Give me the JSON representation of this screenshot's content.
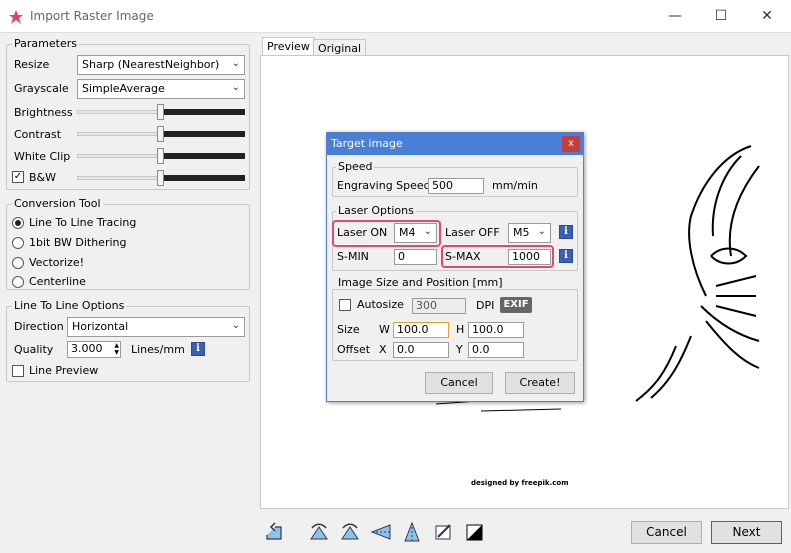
{
  "window": {
    "title": "Import Raster Image",
    "minimize": "—",
    "maximize": "☐",
    "close": "✕"
  },
  "parameters": {
    "title": "Parameters",
    "resize_label": "Resize",
    "resize_value": "Sharp (NearestNeighbor)",
    "grayscale_label": "Grayscale",
    "grayscale_value": "SimpleAverage",
    "brightness_label": "Brightness",
    "contrast_label": "Contrast",
    "white_clip_label": "White Clip",
    "bw_label": "B&W",
    "bw_checked": true,
    "slider_level": 0.5
  },
  "conversion_tool": {
    "title": "Conversion Tool",
    "options": [
      "Line To Line Tracing",
      "1bit BW Dithering",
      "Vectorize!",
      "Centerline"
    ],
    "selected": 0
  },
  "line_options": {
    "title": "Line To Line Options",
    "direction_label": "Direction",
    "direction_value": "Horizontal",
    "quality_label": "Quality",
    "quality_value": "3.000",
    "quality_unit": "Lines/mm",
    "line_preview_label": "Line Preview"
  },
  "tabs": [
    "Preview",
    "Original"
  ],
  "preview": {
    "credit": "designed by  freepik.com"
  },
  "dialog": {
    "title": "Target image",
    "close": "x",
    "speed_group": "Speed",
    "engraving_speed_label": "Engraving Speed",
    "engraving_speed_value": "500",
    "speed_unit": "mm/min",
    "laser_group": "Laser Options",
    "laser_on_label": "Laser ON",
    "laser_on_value": "M4",
    "laser_off_label": "Laser OFF",
    "laser_off_value": "M5",
    "smin_label": "S-MIN",
    "smin_value": "0",
    "smax_label": "S-MAX",
    "smax_value": "1000",
    "size_group": "Image Size and Position [mm]",
    "autosize_label": "Autosize",
    "dpi_value": "300",
    "dpi_label": "DPI",
    "exif_label": "EXIF",
    "size_label": "Size",
    "w_label": "W",
    "w_value": "100.0",
    "h_label": "H",
    "h_value": "100.0",
    "offset_label": "Offset",
    "x_label": "X",
    "x_value": "0.0",
    "y_label": "Y",
    "y_value": "0.0",
    "cancel": "Cancel",
    "create": "Create!"
  },
  "footer": {
    "cancel": "Cancel",
    "next": "Next"
  },
  "colors": {
    "accent": "#4a7fd9",
    "highlight": "#e24a6e",
    "info": "#3a5fb5"
  }
}
